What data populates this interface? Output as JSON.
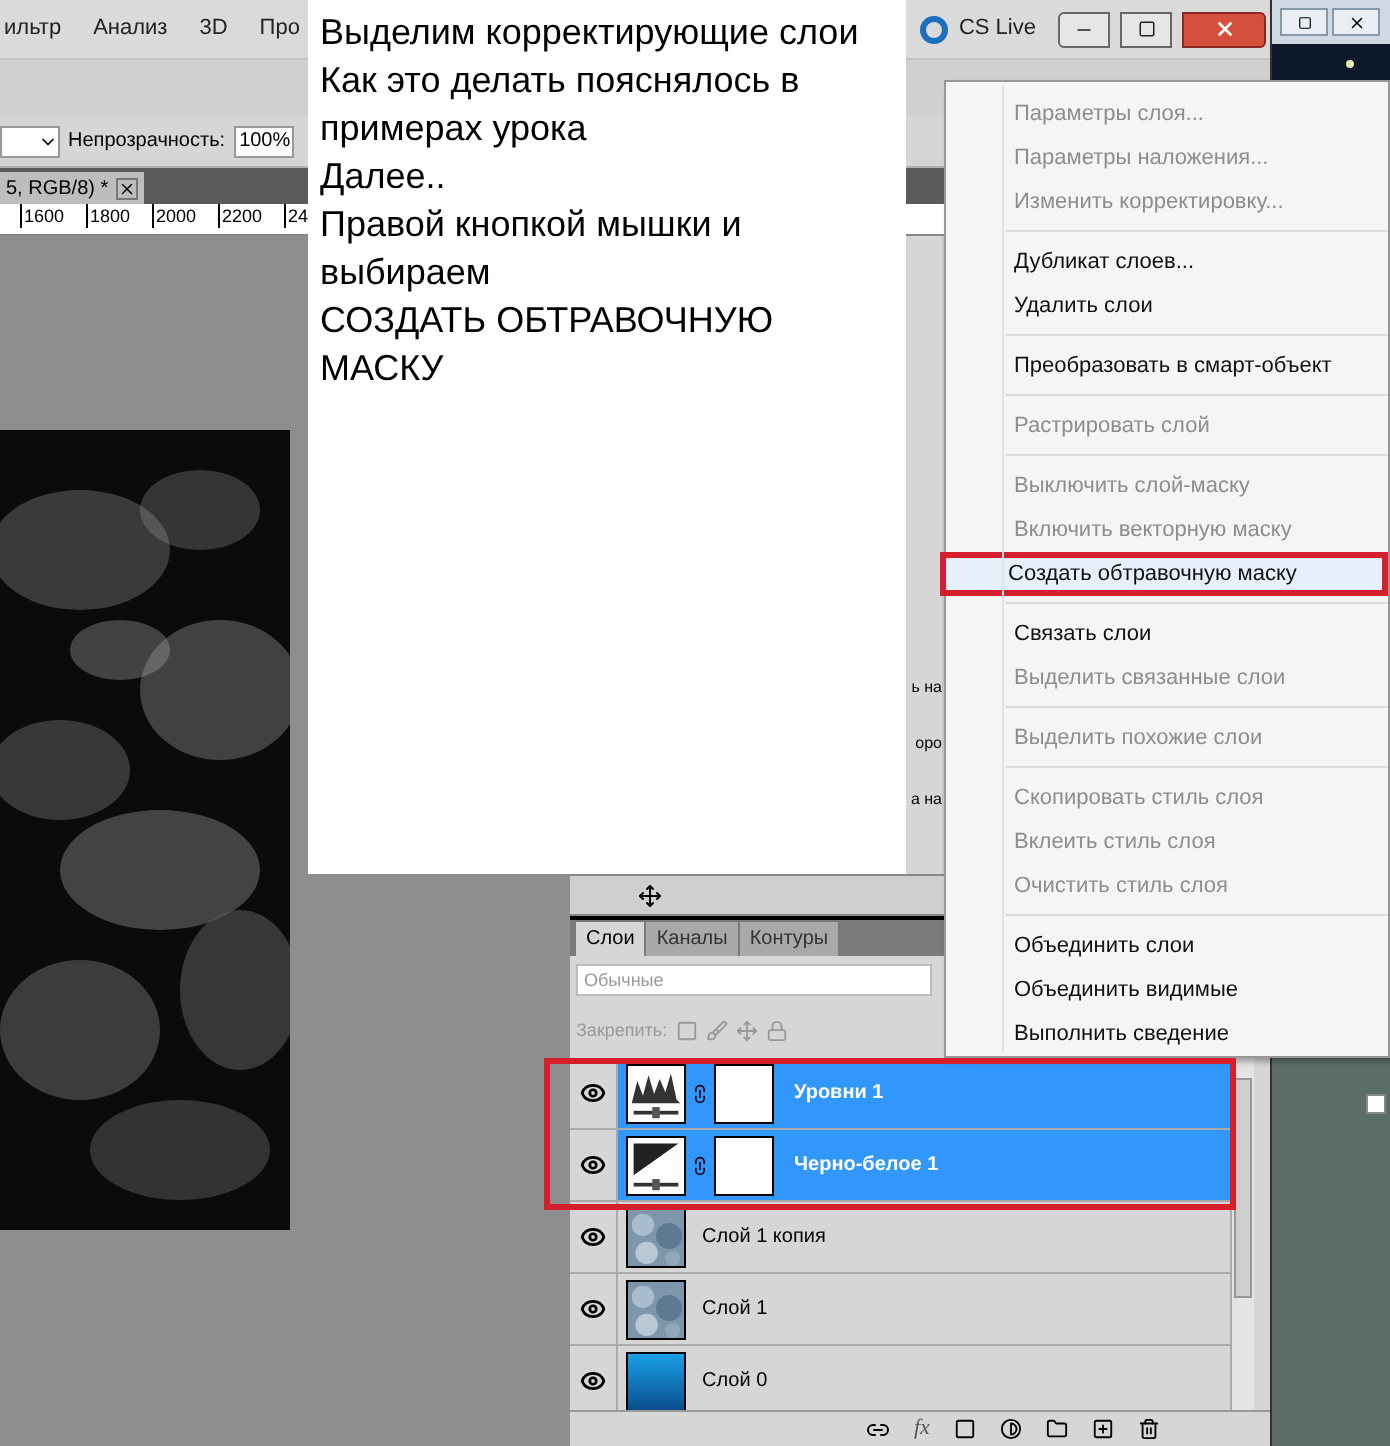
{
  "menu_bar": {
    "items": [
      "ильтр",
      "Анализ",
      "3D",
      "Про"
    ],
    "cs_live": "CS Live"
  },
  "options_bar": {
    "opacity_label": "Непрозрачность:",
    "opacity_value": "100%"
  },
  "document_tab": {
    "title": "5, RGB/8) *"
  },
  "ruler": {
    "ticks": [
      "1600",
      "1800",
      "2000",
      "2200",
      "24"
    ]
  },
  "panel_slivers": [
    "ь на",
    "оро",
    "а на"
  ],
  "layers_panel": {
    "tabs": [
      {
        "label": "Слои",
        "selected": true
      },
      {
        "label": "Каналы",
        "selected": false
      },
      {
        "label": "Контуры",
        "selected": false
      }
    ],
    "blend_mode": {
      "placeholder": "Обычные"
    },
    "lock_label": "Закрепить:",
    "layers": [
      {
        "name": "Уровни 1",
        "kind": "levels",
        "selected": true,
        "visible": true
      },
      {
        "name": "Черно-белое 1",
        "kind": "black_white",
        "selected": true,
        "visible": true
      },
      {
        "name": "Слой 1 копия",
        "kind": "texture",
        "selected": false,
        "visible": true
      },
      {
        "name": "Слой 1",
        "kind": "texture",
        "selected": false,
        "visible": true
      },
      {
        "name": "Слой 0",
        "kind": "gradient",
        "selected": false,
        "visible": true
      }
    ],
    "toolbar_fx": "fx"
  },
  "context_menu": {
    "groups": [
      [
        {
          "label": "Параметры слоя...",
          "disabled": true,
          "selected": false
        },
        {
          "label": "Параметры наложения...",
          "disabled": true,
          "selected": false
        },
        {
          "label": "Изменить корректировку...",
          "disabled": true,
          "selected": false
        }
      ],
      [
        {
          "label": "Дубликат слоев...",
          "disabled": false,
          "selected": false
        },
        {
          "label": "Удалить слои",
          "disabled": false,
          "selected": false
        }
      ],
      [
        {
          "label": "Преобразовать в смарт-объект",
          "disabled": false,
          "selected": false
        }
      ],
      [
        {
          "label": "Растрировать слой",
          "disabled": true,
          "selected": false
        }
      ],
      [
        {
          "label": "Выключить слой-маску",
          "disabled": true,
          "selected": false
        },
        {
          "label": "Включить векторную маску",
          "disabled": true,
          "selected": false
        },
        {
          "label": "Создать обтравочную маску",
          "disabled": false,
          "selected": true
        }
      ],
      [
        {
          "label": "Связать слои",
          "disabled": false,
          "selected": false
        },
        {
          "label": "Выделить связанные слои",
          "disabled": true,
          "selected": false
        }
      ],
      [
        {
          "label": "Выделить похожие слои",
          "disabled": true,
          "selected": false
        }
      ],
      [
        {
          "label": "Скопировать стиль слоя",
          "disabled": true,
          "selected": false
        },
        {
          "label": "Вклеить стиль слоя",
          "disabled": true,
          "selected": false
        },
        {
          "label": "Очистить стиль слоя",
          "disabled": true,
          "selected": false
        }
      ],
      [
        {
          "label": "Объединить слои",
          "disabled": false,
          "selected": false
        },
        {
          "label": "Объединить видимые",
          "disabled": false,
          "selected": false
        },
        {
          "label": "Выполнить сведение",
          "disabled": false,
          "selected": false
        }
      ]
    ]
  },
  "note": {
    "lines": [
      "Выделим корректирующие слои",
      "Как это делать пояснялось в примерах урока",
      "Далее..",
      "Правой кнопкой мышки и выбираем",
      "СОЗДАТЬ ОБТРАВОЧНУЮ МАСКУ"
    ]
  }
}
